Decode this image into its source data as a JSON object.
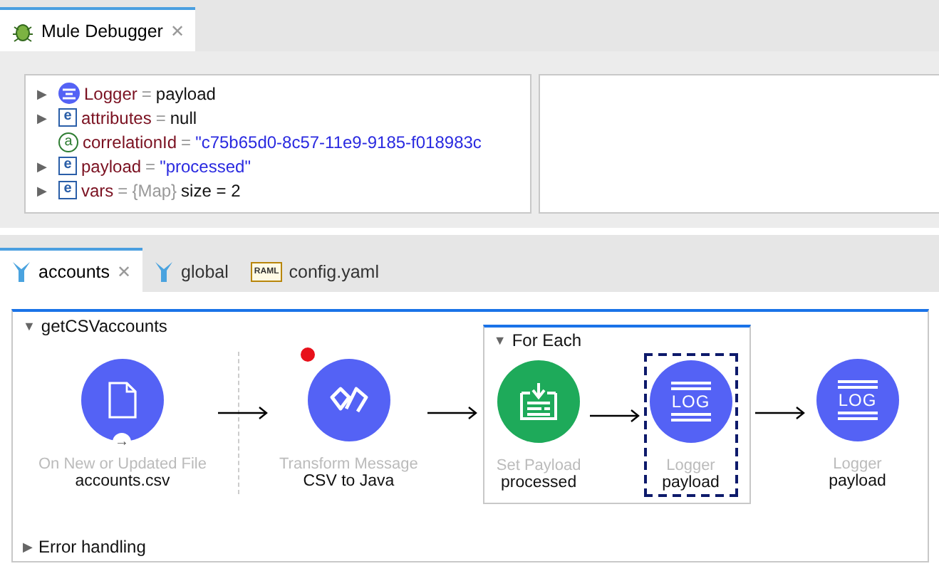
{
  "debugger_tab": {
    "label": "Mule Debugger",
    "selected": true,
    "close": "✕"
  },
  "variables": [
    {
      "kind": "logger",
      "toggle": "▶",
      "name": "Logger",
      "operator": "=",
      "value": "payload",
      "quoted": false
    },
    {
      "kind": "element",
      "toggle": "▶",
      "badge": "e",
      "name": "attributes",
      "operator": "=",
      "value": "null",
      "quoted": false
    },
    {
      "kind": "attribute",
      "badge": "a",
      "name": "correlationId",
      "operator": "=",
      "value": "\"c75b65d0-8c57-11e9-9185-f018983c",
      "quoted": true
    },
    {
      "kind": "element",
      "toggle": "▶",
      "badge": "e",
      "name": "payload",
      "operator": "=",
      "value": "\"processed\"",
      "quoted": true
    },
    {
      "kind": "element",
      "toggle": "▶",
      "badge": "e",
      "name": "vars",
      "operator": "=",
      "type": "{Map}",
      "value": "size = 2",
      "quoted": false
    }
  ],
  "editor_tabs": [
    {
      "kind": "flow",
      "label": "accounts",
      "selected": true,
      "close": "✕"
    },
    {
      "kind": "flow",
      "label": "global",
      "selected": false
    },
    {
      "kind": "raml",
      "icon_label": "RAML",
      "label": "config.yaml",
      "selected": false
    }
  ],
  "flow": {
    "name": "getCSVaccounts",
    "toggle": "▼",
    "items": [
      {
        "kind": "source",
        "badge": "→",
        "color": "#5462f5",
        "title": "On New or Updated File",
        "subtitle": "accounts.csv",
        "breakpoint": false,
        "selected": false
      },
      {
        "kind": "transform",
        "color": "#5462f5",
        "title": "Transform Message",
        "subtitle": "CSV to Java",
        "breakpoint": true,
        "selected": false
      },
      {
        "kind": "scope",
        "toggle": "▼",
        "title": "For Each",
        "children": [
          {
            "kind": "set-payload",
            "color": "#1eaa5a",
            "title": "Set Payload",
            "subtitle": "processed",
            "breakpoint": false,
            "selected": false
          },
          {
            "kind": "logger",
            "icon_label": "LOG",
            "color": "#5462f5",
            "title": "Logger",
            "subtitle": "payload",
            "breakpoint": false,
            "selected": true
          }
        ]
      },
      {
        "kind": "logger",
        "icon_label": "LOG",
        "color": "#5462f5",
        "title": "Logger",
        "subtitle": "payload",
        "breakpoint": false,
        "selected": false
      }
    ],
    "error_handling": {
      "toggle": "▶",
      "label": "Error handling"
    }
  }
}
